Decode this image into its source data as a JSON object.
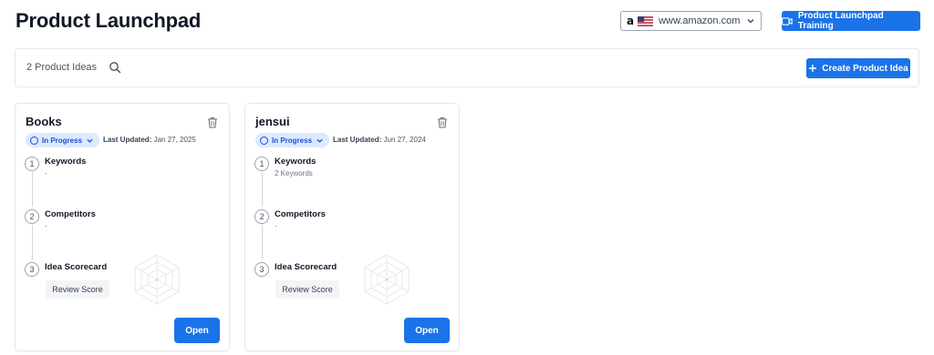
{
  "header": {
    "title": "Product Launchpad",
    "marketplace": {
      "label": "www.amazon.com",
      "icon": "amazon-logo-icon",
      "flag": "us-flag-icon"
    },
    "training_button": {
      "label": "Product Launchpad Training",
      "icon": "video-camera-icon"
    }
  },
  "toolbar": {
    "count_label": "2 Product Ideas",
    "create_button": {
      "label": "Create Product Idea",
      "icon": "plus-icon"
    }
  },
  "cards": [
    {
      "title": "Books",
      "status": "In Progress",
      "last_updated_label": "Last Updated:",
      "last_updated": "Jan 27, 2025",
      "steps": [
        {
          "number": "1",
          "title": "Keywords",
          "sub": "-"
        },
        {
          "number": "2",
          "title": "Competitors",
          "sub": "-"
        },
        {
          "number": "3",
          "title": "Idea Scorecard"
        }
      ],
      "review_label": "Review Score",
      "radar_center": "-",
      "open_label": "Open"
    },
    {
      "title": "jensui",
      "status": "In Progress",
      "last_updated_label": "Last Updated:",
      "last_updated": "Jun 27, 2024",
      "steps": [
        {
          "number": "1",
          "title": "Keywords",
          "sub": "2 Keywords"
        },
        {
          "number": "2",
          "title": "Competitors",
          "sub": "-"
        },
        {
          "number": "3",
          "title": "Idea Scorecard"
        }
      ],
      "review_label": "Review Score",
      "radar_center": "-",
      "open_label": "Open"
    }
  ],
  "colors": {
    "primary": "#1a73e8",
    "status_bg": "#dbeafe",
    "status_text": "#1d4ed8"
  }
}
